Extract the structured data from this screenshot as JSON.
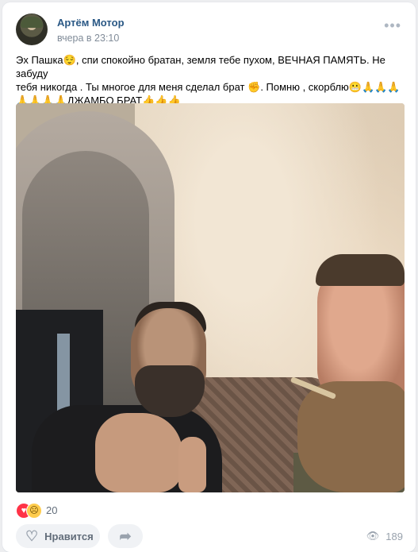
{
  "post": {
    "author": "Артём Мотор",
    "time": "вчера в 23:10",
    "more_icon": "more-horizontal-icon",
    "text_line1_a": "Эх Пашка",
    "text_line1_b": ", спи спокойно братан, земля тебе пухом, ВЕЧНАЯ ПАМЯТЬ. Не забуду",
    "text_line2_a": "тебя никогда . Ты многое для меня сделал брат ",
    "text_line2_b": ". Помню , скорблю",
    "text_line3": "ДЖАМБО БРАТ",
    "photo_alt": "photo"
  },
  "reactions": {
    "count": "20",
    "icons": [
      "heart-reaction-icon",
      "sad-reaction-icon"
    ]
  },
  "actions": {
    "like_label": "Нравится",
    "views": "189"
  },
  "colors": {
    "author": "#2a5885",
    "secondary": "#818c99",
    "button_bg": "#f0f2f5"
  }
}
